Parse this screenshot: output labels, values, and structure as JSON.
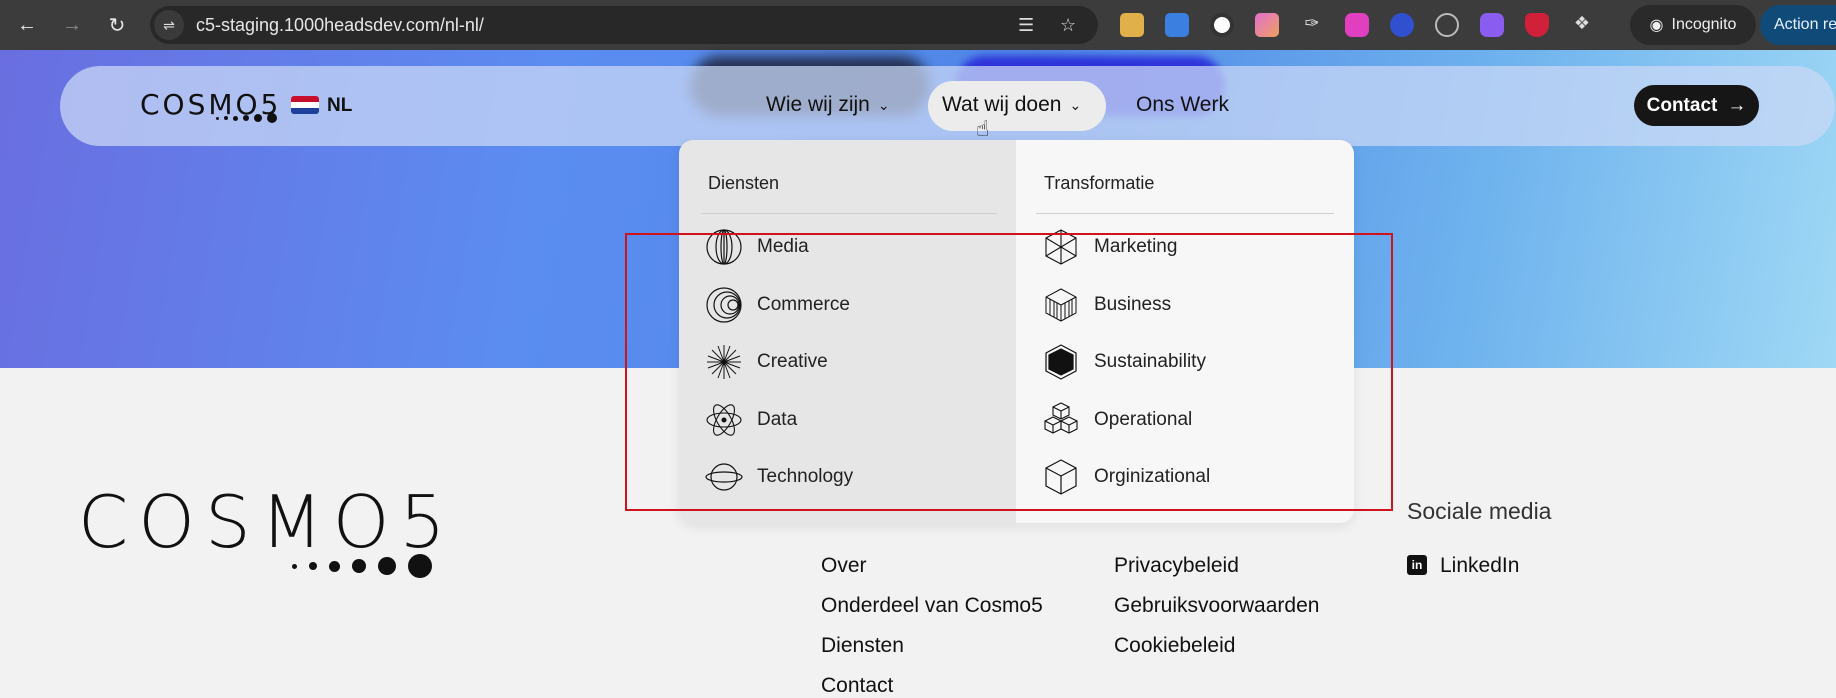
{
  "browser": {
    "url": "c5-staging.1000headsdev.com/nl-nl/",
    "incognito_label": "Incognito",
    "action_label": "Action re"
  },
  "site": {
    "logo_text": "COSMO5",
    "language": "NL",
    "nav": {
      "who": "Wie wij zijn",
      "what": "Wat wij doen",
      "work": "Ons Werk",
      "contact": "Contact"
    },
    "dropdown": {
      "left_title": "Diensten",
      "right_title": "Transformatie",
      "left_items": [
        "Media",
        "Commerce",
        "Creative",
        "Data",
        "Technology"
      ],
      "right_items": [
        "Marketing",
        "Business",
        "Sustainability",
        "Operational",
        "Orginizational"
      ]
    }
  },
  "footer": {
    "logo_text": "COSMO5",
    "col1": [
      "Over",
      "Onderdeel van Cosmo5",
      "Diensten",
      "Contact"
    ],
    "col2": [
      "Privacybeleid",
      "Gebruiksvoorwaarden",
      "Cookiebeleid"
    ],
    "social_heading": "Sociale media",
    "social_link": "LinkedIn"
  },
  "colors": {
    "highlight": "#d0121c",
    "contact_button": "#161616"
  }
}
